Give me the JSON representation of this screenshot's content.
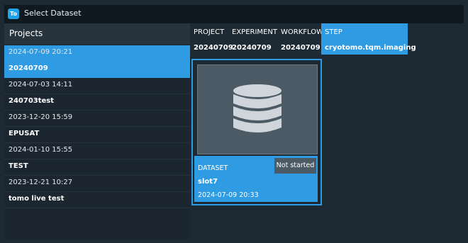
{
  "window": {
    "icon_text": "To",
    "title": "Select Dataset"
  },
  "projects": {
    "header": "Projects",
    "items": [
      {
        "date": "2024-07-09 20:21",
        "name": "20240709",
        "selected": true
      },
      {
        "date": "2024-07-03 14:11",
        "name": "240703test",
        "selected": false
      },
      {
        "date": "2023-12-20 15:59",
        "name": "EPUSAT",
        "selected": false
      },
      {
        "date": "2024-01-10 15:55",
        "name": "TEST",
        "selected": false
      },
      {
        "date": "2023-12-21 10:27",
        "name": "tomo live test",
        "selected": false
      }
    ]
  },
  "path": {
    "columns": [
      {
        "header": "PROJECT",
        "value": "20240709"
      },
      {
        "header": "EXPERIMENT",
        "value": "20240709"
      },
      {
        "header": "WORKFLOW",
        "value": "20240709"
      },
      {
        "header": "STEP",
        "value": "cryotomo.tqm.imaging"
      }
    ]
  },
  "dataset_card": {
    "thumbnail_icon": "database-icon",
    "label": "DATASET",
    "name": "slot7",
    "date": "2024-07-09 20:33",
    "status": "Not started"
  },
  "colors": {
    "accent": "#2f9be3",
    "background": "#1e2a33",
    "titlebar": "#101820"
  }
}
